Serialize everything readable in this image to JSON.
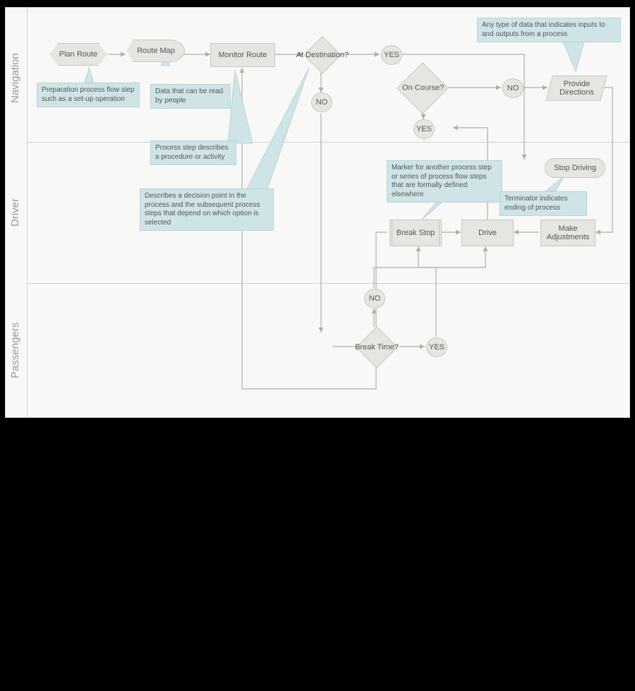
{
  "lanes": {
    "nav": "Navigation",
    "driver": "Driver",
    "passengers": "Passengers"
  },
  "nodes": {
    "plan_route": "Plan Route",
    "route_map": "Route Map",
    "monitor_route": "Monitor Route",
    "at_destination": "At Destination?",
    "yes1": "YES",
    "no1": "NO",
    "on_course": "On Course?",
    "no2": "NO",
    "yes2": "YES",
    "provide_directions": "Provide\nDirections",
    "stop_driving": "Stop Driving",
    "break_stop": "Break Stop",
    "drive": "Drive",
    "make_adjustments": "Make\nAdjustments",
    "no3": "NO",
    "break_time": "Break Time?",
    "yes3": "YES"
  },
  "callouts": {
    "c1": "Preparation process flow step such as a set-up operation",
    "c2": "Data that can be read by people",
    "c3": "Process step describes a procedure or activity",
    "c4": "Describes a decision point in the process and the subsequent process steps that depend on which option is selected",
    "c5": "Marker for another process step or series of process flow steps that are formally defined elsewhere",
    "c6": "Terminator indicates ending of process",
    "c7": "Any type of data that indicates inputs to and outputs from a process"
  }
}
